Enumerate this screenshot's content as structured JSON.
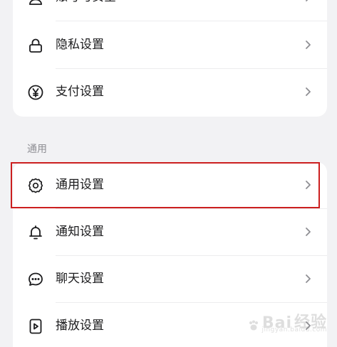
{
  "settings": {
    "account_security": {
      "label": "账号与安全",
      "icon": "user-icon"
    },
    "privacy": {
      "label": "隐私设置",
      "icon": "lock-icon"
    },
    "payment": {
      "label": "支付设置",
      "icon": "yen-circle-icon"
    },
    "general_section_title": "通用",
    "general": {
      "label": "通用设置",
      "icon": "gear-icon"
    },
    "notification": {
      "label": "通知设置",
      "icon": "bell-icon"
    },
    "chat": {
      "label": "聊天设置",
      "icon": "chat-bubble-icon"
    },
    "playback": {
      "label": "播放设置",
      "icon": "play-icon"
    }
  },
  "colors": {
    "background": "#f2f2f4",
    "card": "#ffffff",
    "highlight_border": "#cc1f1f",
    "section_title": "#8e8e93"
  }
}
